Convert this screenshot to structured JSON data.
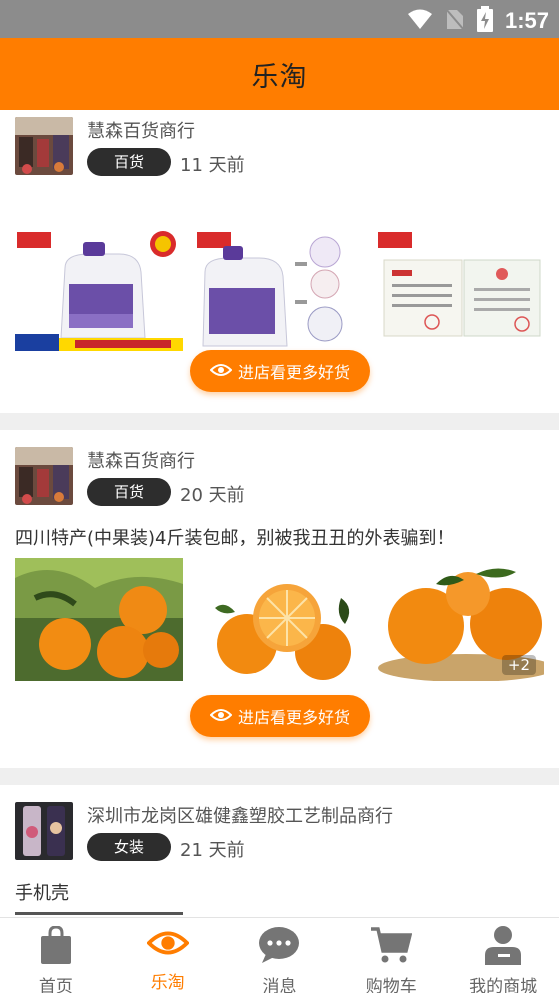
{
  "status_bar": {
    "time": "1:57"
  },
  "header": {
    "title": "乐淘"
  },
  "feed": [
    {
      "shop_name": "慧森百货商行",
      "category": "百货",
      "time_ago": "11 天前",
      "description": "",
      "more_count": "",
      "button_label": "进店看更多好货"
    },
    {
      "shop_name": "慧森百货商行",
      "category": "百货",
      "time_ago": "20 天前",
      "description": "四川特产(中果装)4斤装包邮，别被我丑丑的外表骗到！",
      "more_count": "+2",
      "button_label": "进店看更多好货"
    },
    {
      "shop_name": "深圳市龙岗区雄健鑫塑胶工艺制品商行",
      "category": "女装",
      "time_ago": "21 天前",
      "description": "手机壳"
    }
  ],
  "tabs": [
    {
      "label": "首页",
      "icon": "shopping-bag-icon",
      "active": false
    },
    {
      "label": "乐淘",
      "icon": "eye-icon",
      "active": true
    },
    {
      "label": "消息",
      "icon": "chat-bubble-icon",
      "active": false
    },
    {
      "label": "购物车",
      "icon": "cart-icon",
      "active": false
    },
    {
      "label": "我的商城",
      "icon": "user-icon",
      "active": false
    }
  ],
  "colors": {
    "accent": "#ff7d00",
    "status_bar": "#8c8c8c",
    "tag_bg": "#2d2d2d"
  }
}
